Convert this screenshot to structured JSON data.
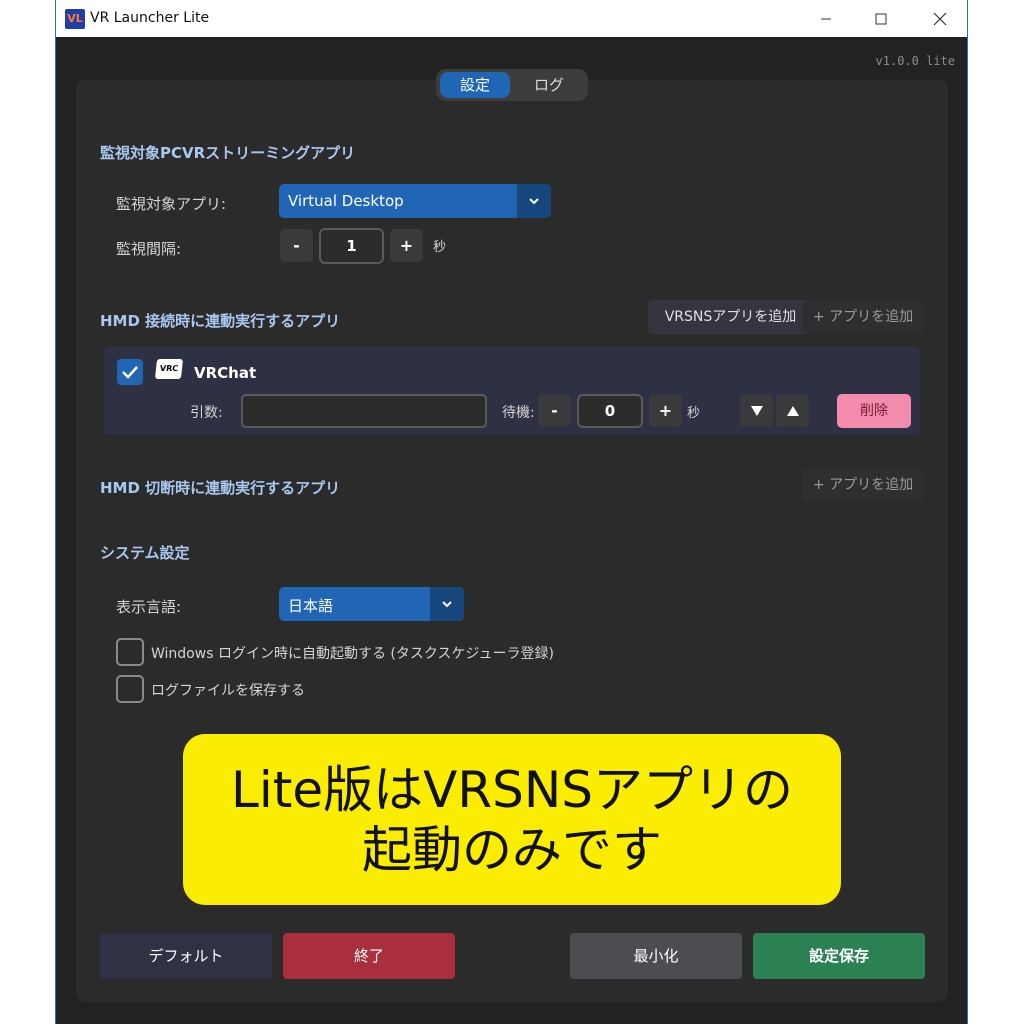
{
  "window": {
    "title": "VR Launcher Lite",
    "logo_text": "VL",
    "version": "v1.0.0 lite"
  },
  "tabs": [
    {
      "label": "設定",
      "active": true
    },
    {
      "label": "ログ",
      "active": false
    }
  ],
  "monitor": {
    "section_title": "監視対象PCVRストリーミングアプリ",
    "app_label": "監視対象アプリ:",
    "app_value": "Virtual Desktop",
    "interval_label": "監視間隔:",
    "interval_value": "1",
    "interval_unit": "秒",
    "minus": "-",
    "plus": "+"
  },
  "connect": {
    "section_title": "HMD 接続時に連動実行するアプリ",
    "add_vrsns_label": "VRSNSアプリを追加",
    "add_app_label": "+ アプリを追加",
    "apps": [
      {
        "name": "VRChat",
        "logo_text": "VRC",
        "checked": true,
        "args_label": "引数:",
        "args_value": "",
        "wait_label": "待機:",
        "wait_value": "0",
        "wait_unit": "秒",
        "delete_label": "削除"
      }
    ]
  },
  "disconnect": {
    "section_title": "HMD 切断時に連動実行するアプリ",
    "add_app_label": "+ アプリを追加"
  },
  "system": {
    "section_title": "システム設定",
    "language_label": "表示言語:",
    "language_value": "日本語",
    "autostart_label": "Windows ログイン時に自動起動する (タスクスケジューラ登録)",
    "autostart_checked": false,
    "savelog_label": "ログファイルを保存する",
    "savelog_checked": false
  },
  "banner": {
    "line1": "Lite版はVRSNSアプリの",
    "line2": "起動のみです"
  },
  "footer": {
    "default_label": "デフォルト",
    "exit_label": "終了",
    "minimize_label": "最小化",
    "save_label": "設定保存"
  },
  "colors": {
    "accent": "#2166b5",
    "section_title": "#a8c8f0",
    "delete": "#f28bac",
    "exit": "#a82f3b",
    "save": "#2b8054",
    "banner": "#fbec03"
  }
}
